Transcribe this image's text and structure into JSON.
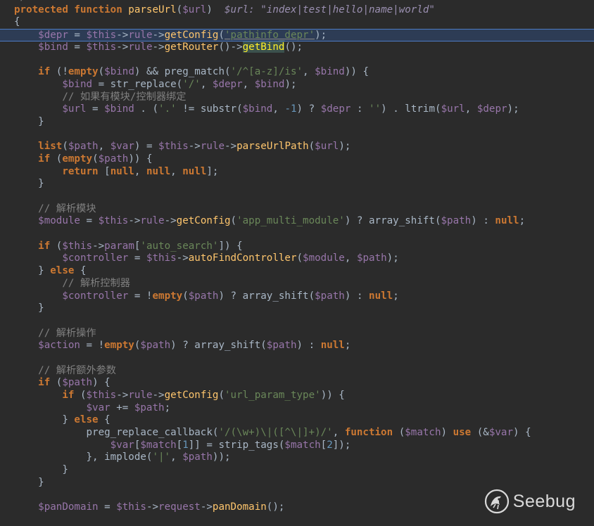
{
  "editor": {
    "lines": [
      {
        "kind": "top",
        "tokens": [
          [
            "cmt",
            "*/"
          ]
        ]
      },
      {
        "kind": "normal",
        "tokens": [
          [
            "kw",
            "protected "
          ],
          [
            "kw",
            "function "
          ],
          [
            "fn",
            "parseUrl"
          ],
          [
            "plain",
            "("
          ],
          [
            "var",
            "$url"
          ],
          [
            "plain",
            ")  "
          ],
          [
            "hint",
            "$url: \"index|test|hello|name|world\""
          ]
        ]
      },
      {
        "kind": "normal",
        "tokens": [
          [
            "plain",
            "{"
          ]
        ]
      },
      {
        "kind": "current",
        "tokens": [
          [
            "plain",
            "    "
          ],
          [
            "var",
            "$depr"
          ],
          [
            "plain",
            " = "
          ],
          [
            "var",
            "$this"
          ],
          [
            "plain",
            "->"
          ],
          [
            "var",
            "rule"
          ],
          [
            "plain",
            "->"
          ],
          [
            "fn",
            "getConfig"
          ],
          [
            "plain",
            "("
          ],
          [
            "str",
            "'pathinfo_depr'"
          ],
          [
            "plain",
            ");"
          ]
        ]
      },
      {
        "kind": "normal",
        "tokens": [
          [
            "plain",
            "    "
          ],
          [
            "var",
            "$bind"
          ],
          [
            "plain",
            " = "
          ],
          [
            "var",
            "$this"
          ],
          [
            "plain",
            "->"
          ],
          [
            "var",
            "rule"
          ],
          [
            "plain",
            "->"
          ],
          [
            "fn",
            "getRouter"
          ],
          [
            "plain",
            "()->"
          ],
          [
            "bindhl",
            "getBind"
          ],
          [
            "plain",
            "();"
          ]
        ]
      },
      {
        "kind": "normal",
        "tokens": []
      },
      {
        "kind": "normal",
        "tokens": [
          [
            "plain",
            "    "
          ],
          [
            "kw",
            "if "
          ],
          [
            "plain",
            "(!"
          ],
          [
            "kw",
            "empty"
          ],
          [
            "plain",
            "("
          ],
          [
            "var",
            "$bind"
          ],
          [
            "plain",
            ") && preg_match("
          ],
          [
            "str",
            "'/^[a-z]/is'"
          ],
          [
            "plain",
            ", "
          ],
          [
            "var",
            "$bind"
          ],
          [
            "plain",
            ")) {"
          ]
        ]
      },
      {
        "kind": "normal",
        "tokens": [
          [
            "plain",
            "        "
          ],
          [
            "var",
            "$bind"
          ],
          [
            "plain",
            " = str_replace("
          ],
          [
            "str",
            "'/'"
          ],
          [
            "plain",
            ", "
          ],
          [
            "var",
            "$depr"
          ],
          [
            "plain",
            ", "
          ],
          [
            "var",
            "$bind"
          ],
          [
            "plain",
            ");"
          ]
        ]
      },
      {
        "kind": "normal",
        "tokens": [
          [
            "plain",
            "        "
          ],
          [
            "cmt",
            "// 如果有模块/控制器绑定"
          ]
        ]
      },
      {
        "kind": "normal",
        "tokens": [
          [
            "plain",
            "        "
          ],
          [
            "var",
            "$url"
          ],
          [
            "plain",
            " = "
          ],
          [
            "var",
            "$bind"
          ],
          [
            "plain",
            " . ("
          ],
          [
            "str",
            "'.'"
          ],
          [
            "plain",
            " != substr("
          ],
          [
            "var",
            "$bind"
          ],
          [
            "plain",
            ", "
          ],
          [
            "num",
            "-1"
          ],
          [
            "plain",
            ") ? "
          ],
          [
            "var",
            "$depr"
          ],
          [
            "plain",
            " : "
          ],
          [
            "str",
            "''"
          ],
          [
            "plain",
            ") . ltrim("
          ],
          [
            "var",
            "$url"
          ],
          [
            "plain",
            ", "
          ],
          [
            "var",
            "$depr"
          ],
          [
            "plain",
            ");"
          ]
        ]
      },
      {
        "kind": "normal",
        "tokens": [
          [
            "plain",
            "    }"
          ]
        ]
      },
      {
        "kind": "normal",
        "tokens": []
      },
      {
        "kind": "normal",
        "tokens": [
          [
            "plain",
            "    "
          ],
          [
            "kw",
            "list"
          ],
          [
            "plain",
            "("
          ],
          [
            "var",
            "$path"
          ],
          [
            "plain",
            ", "
          ],
          [
            "var",
            "$var"
          ],
          [
            "plain",
            ") = "
          ],
          [
            "var",
            "$this"
          ],
          [
            "plain",
            "->"
          ],
          [
            "var",
            "rule"
          ],
          [
            "plain",
            "->"
          ],
          [
            "fn",
            "parseUrlPath"
          ],
          [
            "plain",
            "("
          ],
          [
            "var",
            "$url"
          ],
          [
            "plain",
            ");"
          ]
        ]
      },
      {
        "kind": "normal",
        "tokens": [
          [
            "plain",
            "    "
          ],
          [
            "kw",
            "if "
          ],
          [
            "plain",
            "("
          ],
          [
            "kw",
            "empty"
          ],
          [
            "plain",
            "("
          ],
          [
            "var",
            "$path"
          ],
          [
            "plain",
            ")) {"
          ]
        ]
      },
      {
        "kind": "normal",
        "tokens": [
          [
            "plain",
            "        "
          ],
          [
            "kw",
            "return "
          ],
          [
            "plain",
            "["
          ],
          [
            "kw",
            "null"
          ],
          [
            "plain",
            ", "
          ],
          [
            "kw",
            "null"
          ],
          [
            "plain",
            ", "
          ],
          [
            "kw",
            "null"
          ],
          [
            "plain",
            "];"
          ]
        ]
      },
      {
        "kind": "normal",
        "tokens": [
          [
            "plain",
            "    }"
          ]
        ]
      },
      {
        "kind": "normal",
        "tokens": []
      },
      {
        "kind": "normal",
        "tokens": [
          [
            "plain",
            "    "
          ],
          [
            "cmt",
            "// 解析模块"
          ]
        ]
      },
      {
        "kind": "normal",
        "tokens": [
          [
            "plain",
            "    "
          ],
          [
            "var",
            "$module"
          ],
          [
            "plain",
            " = "
          ],
          [
            "var",
            "$this"
          ],
          [
            "plain",
            "->"
          ],
          [
            "var",
            "rule"
          ],
          [
            "plain",
            "->"
          ],
          [
            "fn",
            "getConfig"
          ],
          [
            "plain",
            "("
          ],
          [
            "str",
            "'app_multi_module'"
          ],
          [
            "plain",
            ") ? array_shift("
          ],
          [
            "var",
            "$path"
          ],
          [
            "plain",
            ") : "
          ],
          [
            "kw",
            "null"
          ],
          [
            "plain",
            ";"
          ]
        ]
      },
      {
        "kind": "normal",
        "tokens": []
      },
      {
        "kind": "normal",
        "tokens": [
          [
            "plain",
            "    "
          ],
          [
            "kw",
            "if "
          ],
          [
            "plain",
            "("
          ],
          [
            "var",
            "$this"
          ],
          [
            "plain",
            "->"
          ],
          [
            "var",
            "param"
          ],
          [
            "plain",
            "["
          ],
          [
            "str",
            "'auto_search'"
          ],
          [
            "plain",
            "]) {"
          ]
        ]
      },
      {
        "kind": "normal",
        "tokens": [
          [
            "plain",
            "        "
          ],
          [
            "var",
            "$controller"
          ],
          [
            "plain",
            " = "
          ],
          [
            "var",
            "$this"
          ],
          [
            "plain",
            "->"
          ],
          [
            "fn",
            "autoFindController"
          ],
          [
            "plain",
            "("
          ],
          [
            "var",
            "$module"
          ],
          [
            "plain",
            ", "
          ],
          [
            "var",
            "$path"
          ],
          [
            "plain",
            ");"
          ]
        ]
      },
      {
        "kind": "normal",
        "tokens": [
          [
            "plain",
            "    } "
          ],
          [
            "kw",
            "else "
          ],
          [
            "plain",
            "{"
          ]
        ]
      },
      {
        "kind": "normal",
        "tokens": [
          [
            "plain",
            "        "
          ],
          [
            "cmt",
            "// 解析控制器"
          ]
        ]
      },
      {
        "kind": "normal",
        "tokens": [
          [
            "plain",
            "        "
          ],
          [
            "var",
            "$controller"
          ],
          [
            "plain",
            " = !"
          ],
          [
            "kw",
            "empty"
          ],
          [
            "plain",
            "("
          ],
          [
            "var",
            "$path"
          ],
          [
            "plain",
            ") ? array_shift("
          ],
          [
            "var",
            "$path"
          ],
          [
            "plain",
            ") : "
          ],
          [
            "kw",
            "null"
          ],
          [
            "plain",
            ";"
          ]
        ]
      },
      {
        "kind": "normal",
        "tokens": [
          [
            "plain",
            "    }"
          ]
        ]
      },
      {
        "kind": "normal",
        "tokens": []
      },
      {
        "kind": "normal",
        "tokens": [
          [
            "plain",
            "    "
          ],
          [
            "cmt",
            "// 解析操作"
          ]
        ]
      },
      {
        "kind": "normal",
        "tokens": [
          [
            "plain",
            "    "
          ],
          [
            "var",
            "$action"
          ],
          [
            "plain",
            " = !"
          ],
          [
            "kw",
            "empty"
          ],
          [
            "plain",
            "("
          ],
          [
            "var",
            "$path"
          ],
          [
            "plain",
            ") ? array_shift("
          ],
          [
            "var",
            "$path"
          ],
          [
            "plain",
            ") : "
          ],
          [
            "kw",
            "null"
          ],
          [
            "plain",
            ";"
          ]
        ]
      },
      {
        "kind": "normal",
        "tokens": []
      },
      {
        "kind": "normal",
        "tokens": [
          [
            "plain",
            "    "
          ],
          [
            "cmt",
            "// 解析额外参数"
          ]
        ]
      },
      {
        "kind": "normal",
        "tokens": [
          [
            "plain",
            "    "
          ],
          [
            "kw",
            "if "
          ],
          [
            "plain",
            "("
          ],
          [
            "var",
            "$path"
          ],
          [
            "plain",
            ") {"
          ]
        ]
      },
      {
        "kind": "normal",
        "tokens": [
          [
            "plain",
            "        "
          ],
          [
            "kw",
            "if "
          ],
          [
            "plain",
            "("
          ],
          [
            "var",
            "$this"
          ],
          [
            "plain",
            "->"
          ],
          [
            "var",
            "rule"
          ],
          [
            "plain",
            "->"
          ],
          [
            "fn",
            "getConfig"
          ],
          [
            "plain",
            "("
          ],
          [
            "str",
            "'url_param_type'"
          ],
          [
            "plain",
            ")) {"
          ]
        ]
      },
      {
        "kind": "normal",
        "tokens": [
          [
            "plain",
            "            "
          ],
          [
            "var",
            "$var"
          ],
          [
            "plain",
            " += "
          ],
          [
            "var",
            "$path"
          ],
          [
            "plain",
            ";"
          ]
        ]
      },
      {
        "kind": "normal",
        "tokens": [
          [
            "plain",
            "        } "
          ],
          [
            "kw",
            "else "
          ],
          [
            "plain",
            "{"
          ]
        ]
      },
      {
        "kind": "normal",
        "tokens": [
          [
            "plain",
            "            preg_replace_callback("
          ],
          [
            "str",
            "'/(\\w+)\\|([^\\|]+)/'"
          ],
          [
            "plain",
            ", "
          ],
          [
            "kw",
            "function "
          ],
          [
            "plain",
            "("
          ],
          [
            "var",
            "$match"
          ],
          [
            "plain",
            ") "
          ],
          [
            "kw",
            "use "
          ],
          [
            "plain",
            "(&"
          ],
          [
            "var",
            "$var"
          ],
          [
            "plain",
            ") {"
          ]
        ]
      },
      {
        "kind": "normal",
        "tokens": [
          [
            "plain",
            "                "
          ],
          [
            "var",
            "$var"
          ],
          [
            "plain",
            "["
          ],
          [
            "var",
            "$match"
          ],
          [
            "plain",
            "["
          ],
          [
            "num",
            "1"
          ],
          [
            "plain",
            "]] = strip_tags("
          ],
          [
            "var",
            "$match"
          ],
          [
            "plain",
            "["
          ],
          [
            "num",
            "2"
          ],
          [
            "plain",
            "]);"
          ]
        ]
      },
      {
        "kind": "normal",
        "tokens": [
          [
            "plain",
            "            }, implode("
          ],
          [
            "str",
            "'|'"
          ],
          [
            "plain",
            ", "
          ],
          [
            "var",
            "$path"
          ],
          [
            "plain",
            "));"
          ]
        ]
      },
      {
        "kind": "normal",
        "tokens": [
          [
            "plain",
            "        }"
          ]
        ]
      },
      {
        "kind": "normal",
        "tokens": [
          [
            "plain",
            "    }"
          ]
        ]
      },
      {
        "kind": "normal",
        "tokens": []
      },
      {
        "kind": "normal",
        "tokens": [
          [
            "plain",
            "    "
          ],
          [
            "var",
            "$panDomain"
          ],
          [
            "plain",
            " = "
          ],
          [
            "var",
            "$this"
          ],
          [
            "plain",
            "->"
          ],
          [
            "var",
            "request"
          ],
          [
            "plain",
            "->"
          ],
          [
            "fn",
            "panDomain"
          ],
          [
            "plain",
            "();"
          ]
        ]
      }
    ]
  },
  "watermark": {
    "brand": "Seebug",
    "icon": "seebug-logo-icon"
  },
  "colors": {
    "background": "#2b2b2b",
    "keyword": "#cc7832",
    "function": "#ffc66d",
    "variable": "#9876aa",
    "string": "#6a8759",
    "comment": "#808080",
    "current_line": "#2d3c55"
  }
}
